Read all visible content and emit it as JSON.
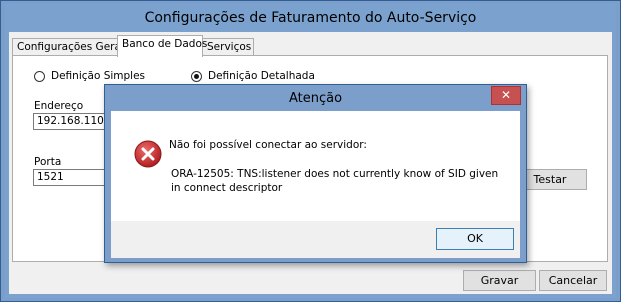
{
  "window": {
    "title": "Configurações de Faturamento do Auto-Serviço"
  },
  "tabs": [
    {
      "label": "Configurações Gerais"
    },
    {
      "label": "Banco de Dados"
    },
    {
      "label": "Serviços"
    }
  ],
  "database": {
    "mode_simple_label": "Definição Simples",
    "mode_detailed_label": "Definição Detalhada",
    "selected_mode": "Definição Detalhada",
    "address_label": "Endereço",
    "address_value": "192.168.110.75",
    "port_label": "Porta",
    "port_value": "1521",
    "test_button": "Testar"
  },
  "footer": {
    "save_button": "Gravar",
    "cancel_button": "Cancelar"
  },
  "dialog": {
    "title": "Atenção",
    "close_symbol": "✕",
    "icon": "error-icon",
    "message_line1": "Não foi possível conectar ao servidor:",
    "message_line2": "ORA-12505: TNS:listener does not currently know of SID given in connect descriptor",
    "ok_button": "OK"
  },
  "colors": {
    "frame": "#7ba2cf",
    "error_red": "#c8282c",
    "close_red": "#c75050"
  }
}
